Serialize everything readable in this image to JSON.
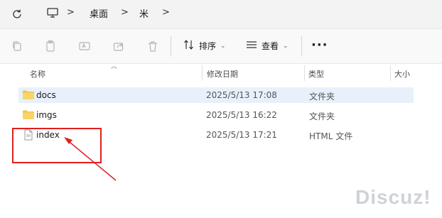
{
  "address_bar": {
    "breadcrumbs": [
      "桌面",
      "米"
    ]
  },
  "toolbar": {
    "sort_label": "排序",
    "view_label": "查看",
    "more_label": "···"
  },
  "columns": {
    "name": "名称",
    "modified": "修改日期",
    "type": "类型",
    "size": "大小"
  },
  "files": [
    {
      "name": "docs",
      "modified": "2025/5/13 17:08",
      "type": "文件夹",
      "icon": "folder-icon"
    },
    {
      "name": "imgs",
      "modified": "2025/5/13 16:22",
      "type": "文件夹",
      "icon": "folder-icon"
    },
    {
      "name": "index",
      "modified": "2025/5/13 17:21",
      "type": "HTML 文件",
      "icon": "html-file-icon"
    }
  ],
  "watermark": "Discuz!",
  "colors": {
    "annotation": "#e02020",
    "selection": "#e8f1fb",
    "folder": "#f3c34a"
  }
}
